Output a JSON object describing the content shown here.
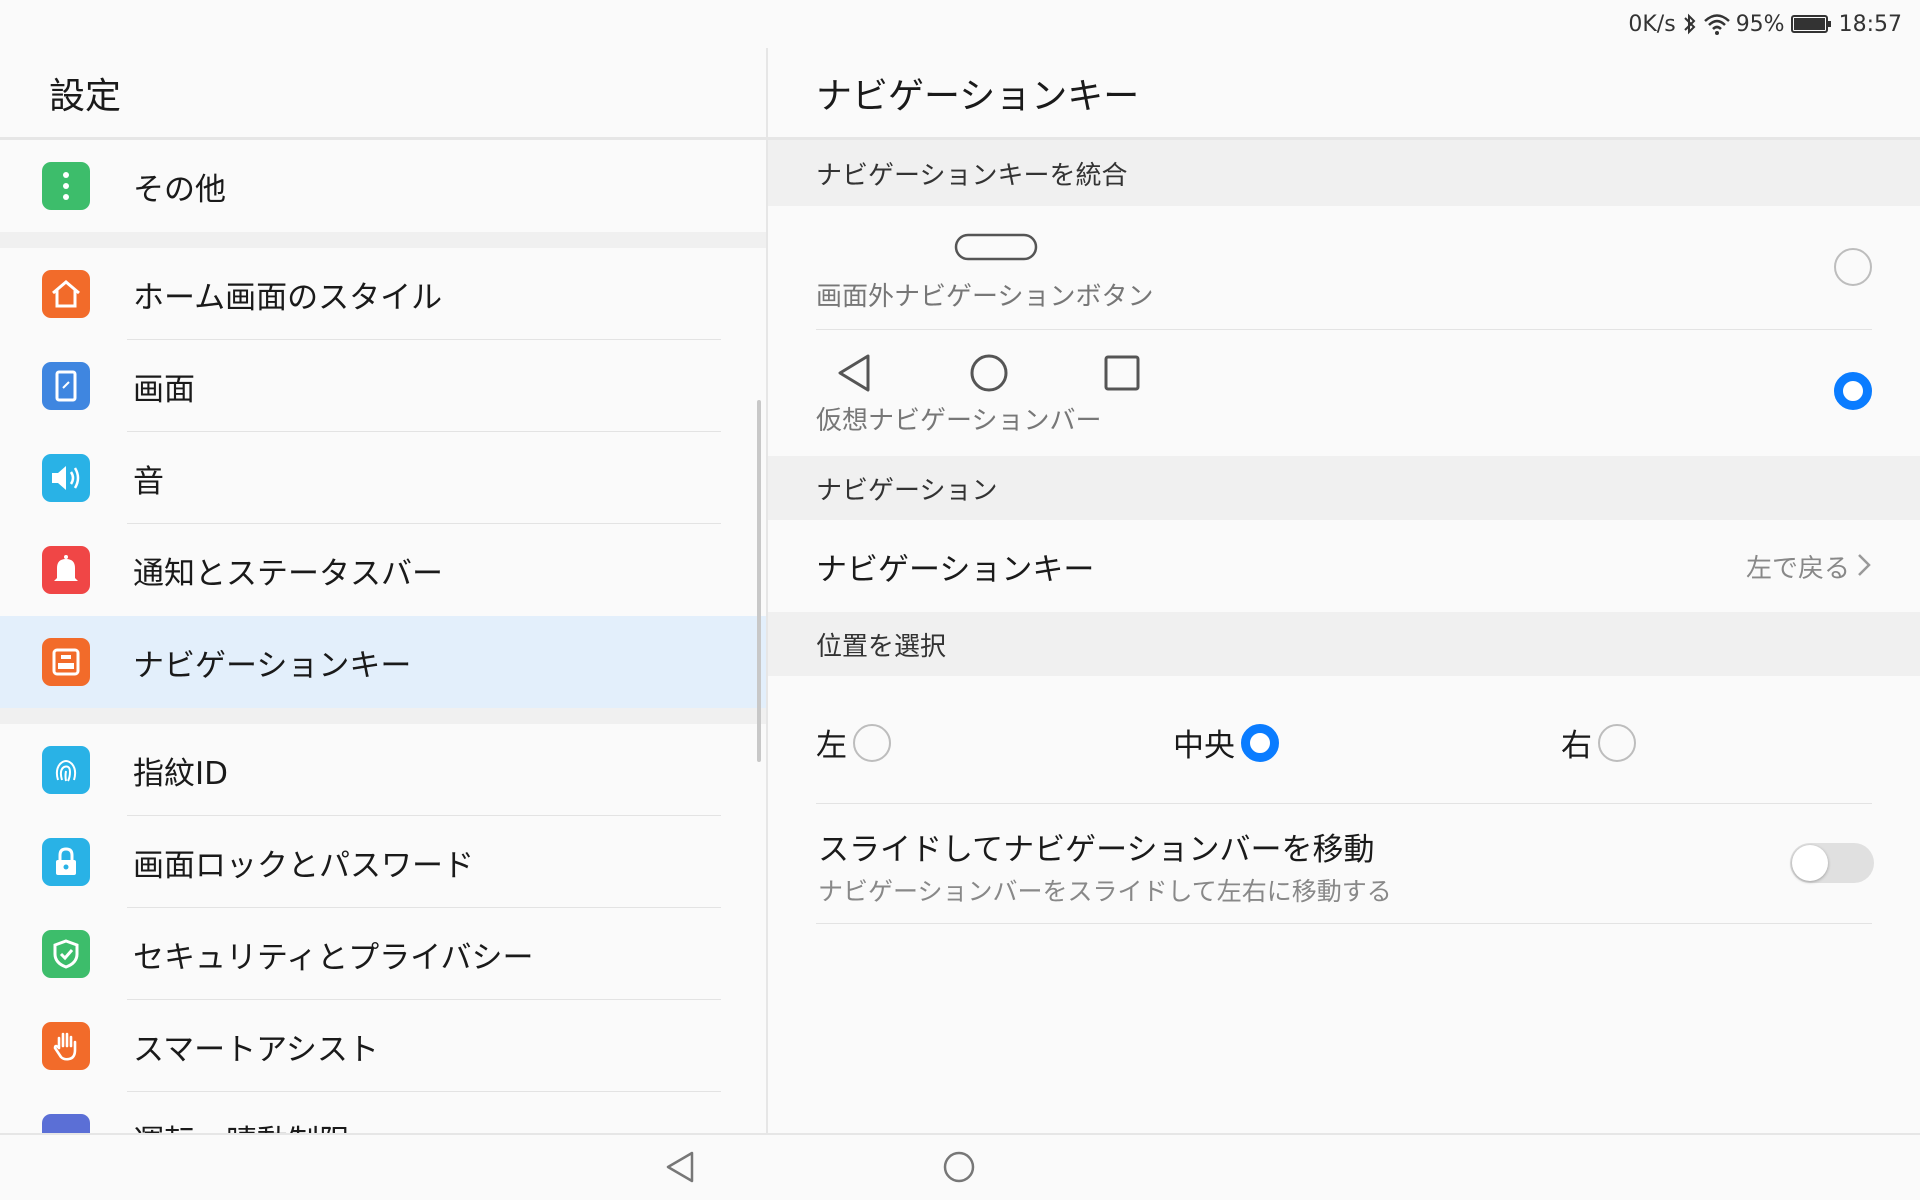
{
  "status_bar": {
    "speed": "0K/s",
    "battery": "95%",
    "time": "18:57"
  },
  "left": {
    "title": "設定",
    "items": [
      {
        "label": "その他",
        "icon": "more-dots-icon",
        "color": "#3dbd6b"
      },
      {
        "label": "ホーム画面のスタイル",
        "icon": "home-icon",
        "color": "#f26b2a"
      },
      {
        "label": "画面",
        "icon": "display-icon",
        "color": "#3f86e0"
      },
      {
        "label": "音",
        "icon": "speaker-icon",
        "color": "#29b2e6"
      },
      {
        "label": "通知とステータスバー",
        "icon": "bell-icon",
        "color": "#f04646"
      },
      {
        "label": "ナビゲーションキー",
        "icon": "navigation-key-icon",
        "color": "#f26b2a"
      },
      {
        "label": "指紋ID",
        "icon": "fingerprint-icon",
        "color": "#29b2e6"
      },
      {
        "label": "画面ロックとパスワード",
        "icon": "lock-icon",
        "color": "#29b2e6"
      },
      {
        "label": "セキュリティとプライバシー",
        "icon": "shield-check-icon",
        "color": "#3dbd6b"
      },
      {
        "label": "スマートアシスト",
        "icon": "hand-icon",
        "color": "#f26b2a"
      },
      {
        "label": "運転・晴動制限",
        "icon": "partial-icon",
        "color": "#5b6fd6"
      }
    ]
  },
  "right": {
    "title": "ナビゲーションキー",
    "section_combine": "ナビゲーションキーを統合",
    "option_offscreen": "画面外ナビゲーションボタン",
    "option_virtual": "仮想ナビゲーションバー",
    "section_navigation": "ナビゲーション",
    "nav_key_label": "ナビゲーションキー",
    "nav_key_value": "左で戻る",
    "section_position": "位置を選択",
    "pos_left": "左",
    "pos_center": "中央",
    "pos_right": "右",
    "slide_title": "スライドしてナビゲーションバーを移動",
    "slide_desc": "ナビゲーションバーをスライドして左右に移動する",
    "slide_enabled": false,
    "accent": "#0a7cff"
  }
}
